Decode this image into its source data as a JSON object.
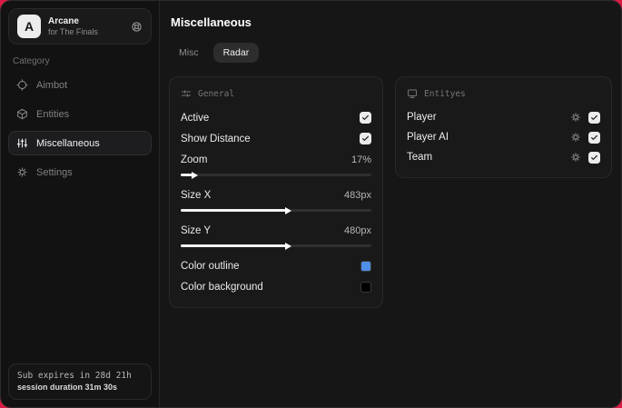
{
  "app": {
    "logo_letter": "A",
    "name": "Arcane",
    "subtitle": "for The Finals",
    "header_icon": "support-icon"
  },
  "sidebar": {
    "category_label": "Category",
    "items": [
      {
        "label": "Aimbot",
        "icon": "crosshair-icon",
        "active": false
      },
      {
        "label": "Entities",
        "icon": "cube-icon",
        "active": false
      },
      {
        "label": "Miscellaneous",
        "icon": "sliders-icon",
        "active": true
      },
      {
        "label": "Settings",
        "icon": "gear-icon",
        "active": false
      }
    ],
    "footer": {
      "expiry": "Sub expires in 28d 21h",
      "session": "session duration 31m 30s"
    }
  },
  "main": {
    "title": "Miscellaneous",
    "tabs": [
      {
        "label": "Misc",
        "active": false
      },
      {
        "label": "Radar",
        "active": true
      }
    ]
  },
  "general_panel": {
    "title": "General",
    "icon": "sliders-horizontal-icon",
    "toggles": [
      {
        "label": "Active",
        "checked": true
      },
      {
        "label": "Show Distance",
        "checked": true
      }
    ],
    "sliders": [
      {
        "label": "Zoom",
        "value": "17%",
        "percent": 6
      },
      {
        "label": "Size X",
        "value": "483px",
        "percent": 55
      },
      {
        "label": "Size Y",
        "value": "480px",
        "percent": 55
      }
    ],
    "colors": [
      {
        "label": "Color outline",
        "hex": "#4f8fe8"
      },
      {
        "label": "Color background",
        "hex": "#000000"
      }
    ]
  },
  "entities_panel": {
    "title": "Entityes",
    "icon": "monitor-icon",
    "rows": [
      {
        "label": "Player",
        "icon": "gear-icon",
        "checked": true
      },
      {
        "label": "Player AI",
        "icon": "gear-icon",
        "checked": true
      },
      {
        "label": "Team",
        "icon": "gear-icon",
        "checked": true
      }
    ]
  },
  "theme": {
    "backdrop": "#d91c44",
    "window_bg": "#161616",
    "sidebar_bg": "#121212",
    "panel_bg": "#191919",
    "checkbox_bg": "#ececec",
    "outline_swatch": "#4f8fe8",
    "background_swatch": "#000000"
  }
}
